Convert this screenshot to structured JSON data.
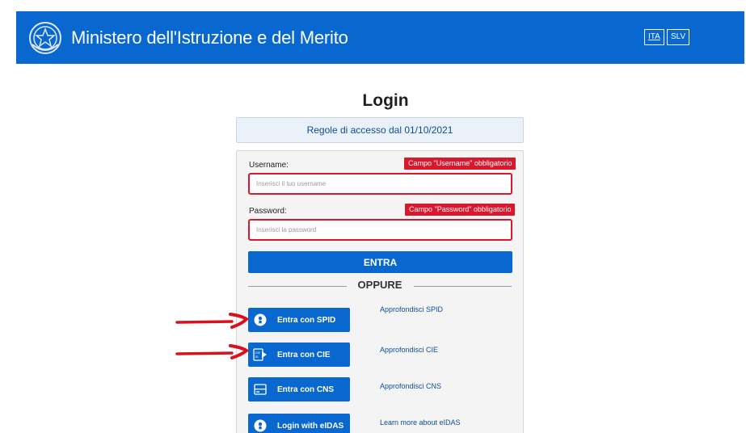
{
  "header": {
    "site_title": "Ministero dell'Istruzione e del Merito",
    "languages": [
      {
        "code": "ITA",
        "active": true
      },
      {
        "code": "SLV",
        "active": false
      }
    ],
    "background_color": "#0868cf"
  },
  "page_title": "Login",
  "rules_link": "Regole di accesso dal 01/10/2021",
  "form": {
    "username": {
      "label": "Username:",
      "placeholder": "Inserisci il tuo username",
      "value": "",
      "error": "Campo \"Username\" obbligatorio"
    },
    "password": {
      "label": "Password:",
      "placeholder": "Inserisci la password",
      "value": "",
      "error": "Campo \"Password\" obbligatorio"
    },
    "submit_label": "ENTRA"
  },
  "separator_label": "OPPURE",
  "alt_logins": [
    {
      "label": "Entra con SPID",
      "icon": "spid-user-icon",
      "learn_more": "Approfondisci SPID"
    },
    {
      "label": "Entra con CIE",
      "icon": "cie-card-icon",
      "learn_more": "Approfondisci CIE"
    },
    {
      "label": "Entra con CNS",
      "icon": "cns-card-icon",
      "learn_more": "Approfondisci CNS"
    },
    {
      "label": "Login with eIDAS",
      "icon": "eidas-user-icon",
      "learn_more": "Learn more about eIDAS"
    }
  ],
  "colors": {
    "primary_blue": "#0868cf",
    "error_red": "#d9182d",
    "link_blue": "#0b4d9c",
    "annotation_arrow": "#d8121d"
  }
}
